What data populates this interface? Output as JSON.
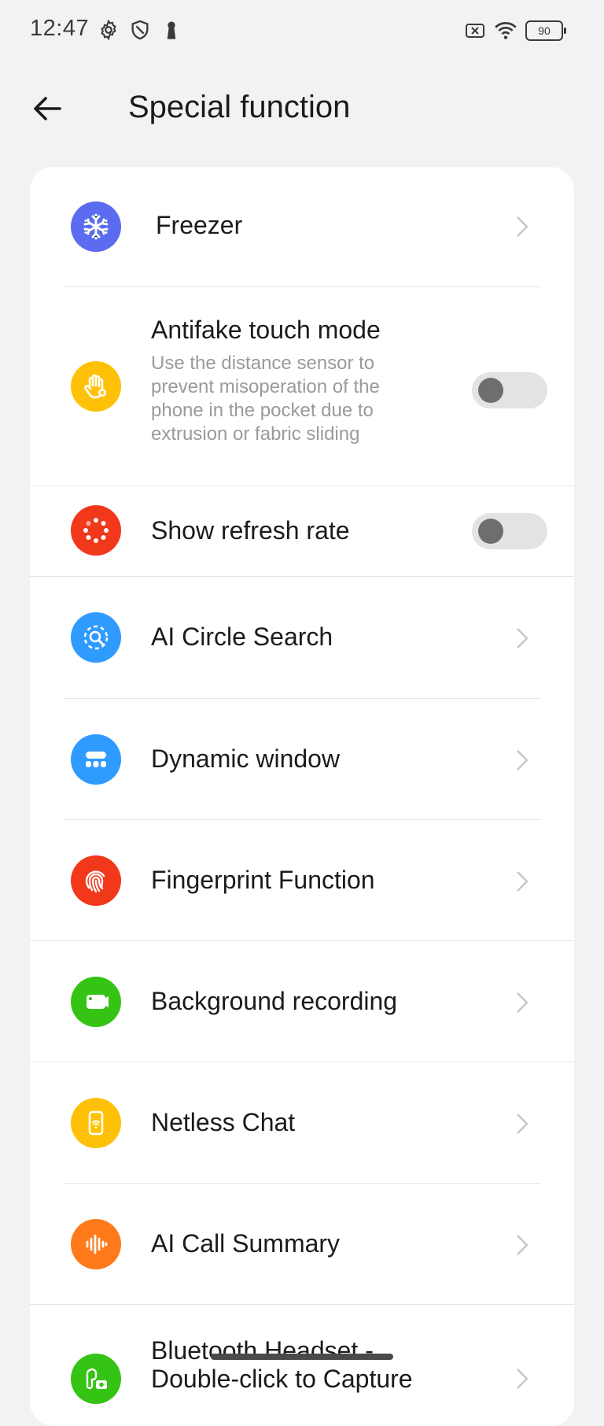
{
  "status": {
    "time": "12:47",
    "battery": "90",
    "icons": [
      "settings-icon",
      "shield-icon",
      "keyhole-icon",
      "sim-off-icon",
      "wifi-icon"
    ]
  },
  "header": {
    "title": "Special function",
    "back_icon": "back-arrow-icon"
  },
  "items": [
    {
      "label": "Freezer",
      "icon": "snowflake-icon",
      "color": "#5b6cf0",
      "control": "chevron"
    },
    {
      "label": "Antifake touch mode",
      "description": "Use the distance sensor to prevent misoperation of the phone in the pocket due to extrusion or fabric sliding",
      "icon": "hand-icon",
      "color": "#ffc107",
      "control": "toggle",
      "toggle_on": false
    },
    {
      "label": "Show refresh rate",
      "icon": "refresh-dots-icon",
      "color": "#f2381b",
      "control": "toggle",
      "toggle_on": false
    },
    {
      "label": "AI Circle Search",
      "icon": "circle-search-icon",
      "color": "#2f9bff",
      "control": "chevron"
    },
    {
      "label": "Dynamic window",
      "icon": "dynamic-window-icon",
      "color": "#2f9bff",
      "control": "chevron"
    },
    {
      "label": "Fingerprint Function",
      "icon": "fingerprint-icon",
      "color": "#f2381b",
      "control": "chevron"
    },
    {
      "label": "Background recording",
      "icon": "recording-icon",
      "color": "#35c415",
      "control": "chevron"
    },
    {
      "label": "Netless Chat",
      "icon": "phone-wave-icon",
      "color": "#ffc107",
      "control": "chevron"
    },
    {
      "label": "AI Call Summary",
      "icon": "audio-wave-icon",
      "color": "#ff7a1a",
      "control": "chevron"
    },
    {
      "label": "Bluetooth Headset - Double-click to Capture",
      "icon": "headset-camera-icon",
      "color": "#35c415",
      "control": "chevron"
    }
  ]
}
